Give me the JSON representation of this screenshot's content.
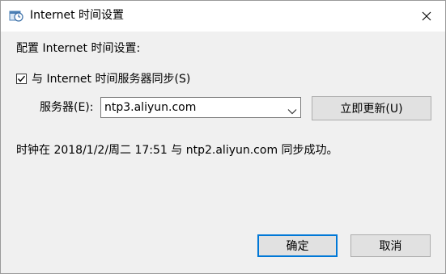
{
  "window": {
    "title": "Internet 时间设置",
    "close_symbol": "✕"
  },
  "main": {
    "config_label": "配置 Internet 时间设置:",
    "sync_checkbox": {
      "label": "与 Internet 时间服务器同步(S)",
      "checked": true
    },
    "server_label": "服务器(E):",
    "server_value": "ntp3.aliyun.com",
    "update_now_label": "立即更新(U)",
    "status_text": "时钟在 2018/1/2/周二 17:51 与 ntp2.aliyun.com 同步成功。"
  },
  "footer": {
    "ok_label": "确定",
    "cancel_label": "取消"
  },
  "colors": {
    "default_button_border": "#0078d7",
    "button_bg": "#e1e1e1",
    "dialog_bg": "#f0f0f0"
  },
  "icons": [
    "clock-globe-icon",
    "close-icon",
    "checkmark-icon",
    "chevron-down-icon"
  ]
}
